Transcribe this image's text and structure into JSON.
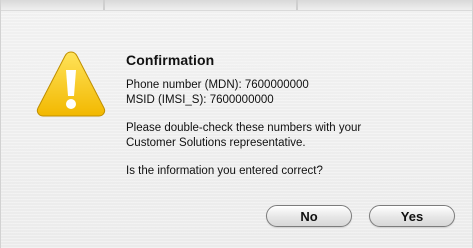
{
  "dialog": {
    "title": "Confirmation",
    "phone_line": "Phone number (MDN): 7600000000",
    "msid_line": "MSID (IMSI_S): 7600000000",
    "instruction_line1": "Please double-check these numbers with your",
    "instruction_line2": "Customer Solutions representative.",
    "question": "Is the information you entered correct?",
    "icon": "warning-icon",
    "accent_color": "#f6c400"
  },
  "buttons": {
    "no_label": "No",
    "yes_label": "Yes"
  }
}
